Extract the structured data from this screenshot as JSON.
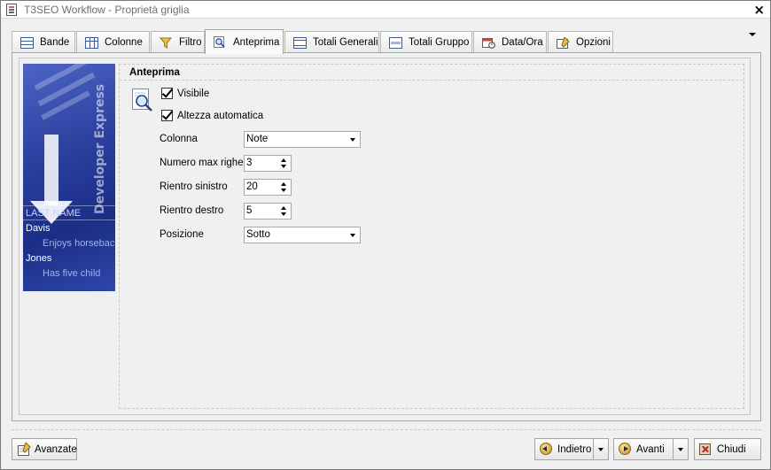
{
  "window": {
    "title": "T3SEO Workflow - Proprietà griglia",
    "close_label": "×"
  },
  "tabs": [
    {
      "label": "Bande",
      "icon": "bands-icon",
      "active": false
    },
    {
      "label": "Colonne",
      "icon": "columns-icon",
      "active": false
    },
    {
      "label": "Filtro",
      "icon": "filter-icon",
      "active": false
    },
    {
      "label": "Anteprima",
      "icon": "magnifier-icon",
      "active": true
    },
    {
      "label": "Totali Generali",
      "icon": "totals-icon",
      "active": false
    },
    {
      "label": "Totali Gruppo",
      "icon": "group-totals-icon",
      "active": false
    },
    {
      "label": "Data/Ora",
      "icon": "calendar-icon",
      "active": false
    },
    {
      "label": "Opzioni",
      "icon": "options-icon",
      "active": false
    }
  ],
  "preview_image": {
    "brand_text": "Developer Express",
    "grid": {
      "header": "LAST NAME",
      "rows": [
        {
          "name": "Davis",
          "note": "Enjoys horseback"
        },
        {
          "name": "Jones",
          "note": "Has five child"
        }
      ]
    }
  },
  "anteprima": {
    "title": "Anteprima",
    "visibile": {
      "label": "Visibile",
      "checked": true
    },
    "altezza_automatica": {
      "label": "Altezza automatica",
      "checked": true
    },
    "colonna": {
      "label": "Colonna",
      "value": "Note"
    },
    "numero_max_righe": {
      "label": "Numero max righe",
      "value": "3"
    },
    "rientro_sinistro": {
      "label": "Rientro sinistro",
      "value": "20"
    },
    "rientro_destro": {
      "label": "Rientro destro",
      "value": "5"
    },
    "posizione": {
      "label": "Posizione",
      "value": "Sotto"
    }
  },
  "buttons": {
    "avanzate": "Avanzate",
    "indietro": "Indietro",
    "avanti": "Avanti",
    "chiudi": "Chiudi"
  },
  "colors": {
    "accent": "#2a3f9e",
    "panel_bg": "#f0f0f0"
  }
}
